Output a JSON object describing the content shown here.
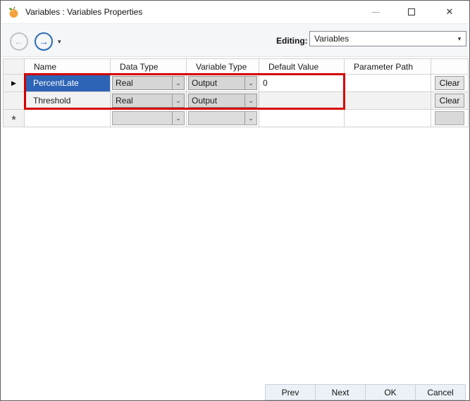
{
  "window": {
    "title": "Variables : Variables Properties"
  },
  "toolbar": {
    "editing_label": "Editing:",
    "editing_value": "Variables"
  },
  "icons": {
    "back_arrow": "←",
    "forward_arrow": "→",
    "caret_down": "▾",
    "chevron_down": "⌄",
    "close": "✕",
    "current_row": "▶",
    "new_row": "*"
  },
  "grid": {
    "columns": {
      "name": "Name",
      "data_type": "Data Type",
      "variable_type": "Variable Type",
      "default_value": "Default Value",
      "parameter_path": "Parameter Path"
    },
    "rows": [
      {
        "name": "PercentLate",
        "data_type": "Real",
        "variable_type": "Output",
        "default_value": "0",
        "parameter_path": "",
        "action_label": "Clear"
      },
      {
        "name": "Threshold",
        "data_type": "Real",
        "variable_type": "Output",
        "default_value": "",
        "parameter_path": "",
        "action_label": "Clear"
      },
      {
        "name": "",
        "data_type": "",
        "variable_type": "",
        "default_value": "",
        "parameter_path": "",
        "action_label": ""
      }
    ]
  },
  "footer": {
    "prev": "Prev",
    "next": "Next",
    "ok": "OK",
    "cancel": "Cancel"
  },
  "colors": {
    "selection_blue": "#2e64b5",
    "highlight_red": "#d40000",
    "nav_forward_blue": "#2b6cb8"
  }
}
